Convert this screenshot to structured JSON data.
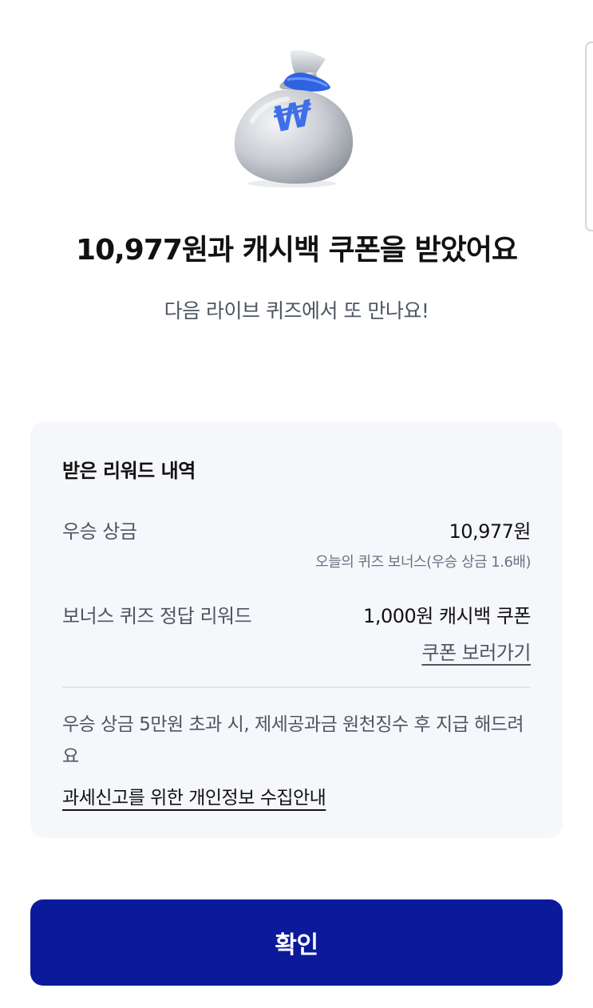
{
  "header": {
    "title": "10,977원과 캐시백 쿠폰을 받았어요",
    "subtitle": "다음 라이브 퀴즈에서 또 만나요!",
    "bag_icon_symbol": "₩"
  },
  "rewards": {
    "section_title": "받은 리워드 내역",
    "prize_label": "우승 상금",
    "prize_value": "10,977원",
    "prize_note": "오늘의 퀴즈 보너스(우승 상금 1.6배)",
    "bonus_label": "보너스 퀴즈 정답 리워드",
    "bonus_value": "1,000원 캐시백 쿠폰",
    "coupon_link": "쿠폰 보러가기",
    "tax_notice": "우승 상금 5만원 초과 시, 제세공과금 원천징수 후 지급 해드려요",
    "privacy_link": "과세신고를 위한 개인정보 수집안내"
  },
  "footer": {
    "confirm_label": "확인"
  },
  "colors": {
    "primary_button": "#0b1a9b",
    "card_background": "#f5f7fb",
    "bag_tie": "#2f63e0"
  }
}
